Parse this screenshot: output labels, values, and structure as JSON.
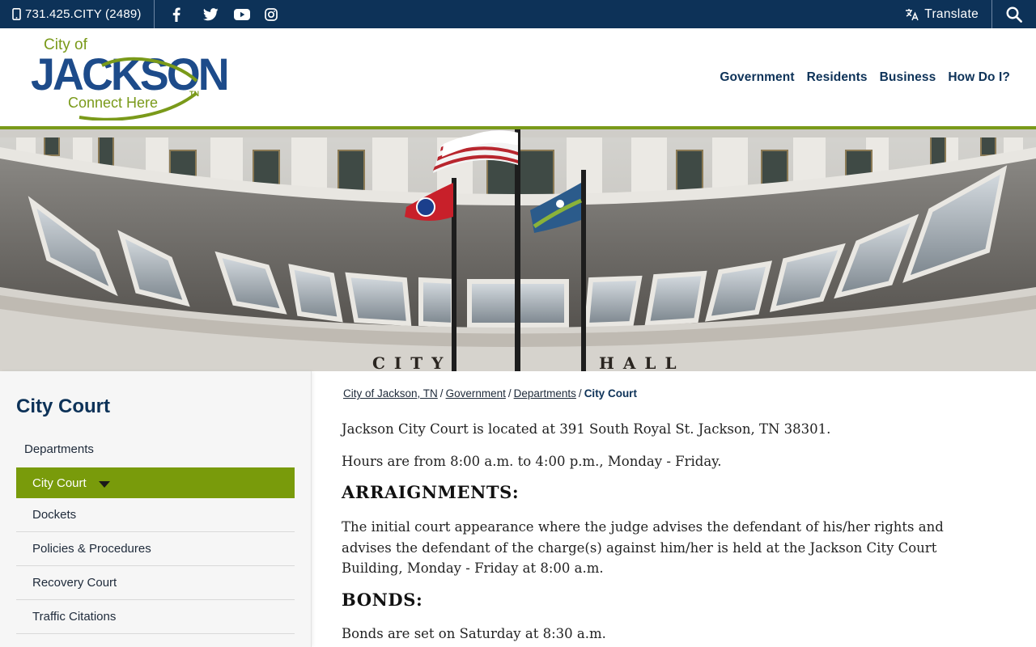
{
  "topbar": {
    "phone": "731.425.CITY (2489)",
    "socials": [
      "facebook-icon",
      "twitter-icon",
      "youtube-icon",
      "instagram-icon"
    ],
    "translate": "Translate",
    "search_icon": "search-icon"
  },
  "logo": {
    "line1": "City of",
    "line2": "JACKSON",
    "line3": "Connect Here",
    "badge": "TN"
  },
  "nav": [
    "Government",
    "Residents",
    "Business",
    "How Do I?"
  ],
  "hero": {
    "building_text_left": "CITY",
    "building_text_right": "HALL"
  },
  "sidebar": {
    "title": "City Court",
    "parent": "Departments",
    "active": "City Court",
    "items": [
      "Dockets",
      "Policies & Procedures",
      "Recovery Court",
      "Traffic Citations"
    ]
  },
  "breadcrumb": {
    "links": [
      "City of Jackson, TN",
      "Government",
      "Departments"
    ],
    "current": "City Court",
    "separator": "/"
  },
  "content": {
    "p1": "Jackson City Court is located at 391 South Royal St. Jackson, TN 38301.",
    "p2": "Hours are from 8:00 a.m. to 4:00 p.m., Monday - Friday.",
    "heading1": "ARRAIGNMENTS:",
    "p3": "The initial court appearance where the judge advises the defendant of his/her rights and advises the defendant of the charge(s) against him/her is held at the Jackson City Court Building, Monday - Friday at 8:00 a.m.",
    "heading2": "BONDS:",
    "p4": "Bonds are set on Saturday at 8:30 a.m."
  },
  "colors": {
    "navy": "#0d3258",
    "green": "#799b0b",
    "logo_blue": "#1d4b8a"
  }
}
